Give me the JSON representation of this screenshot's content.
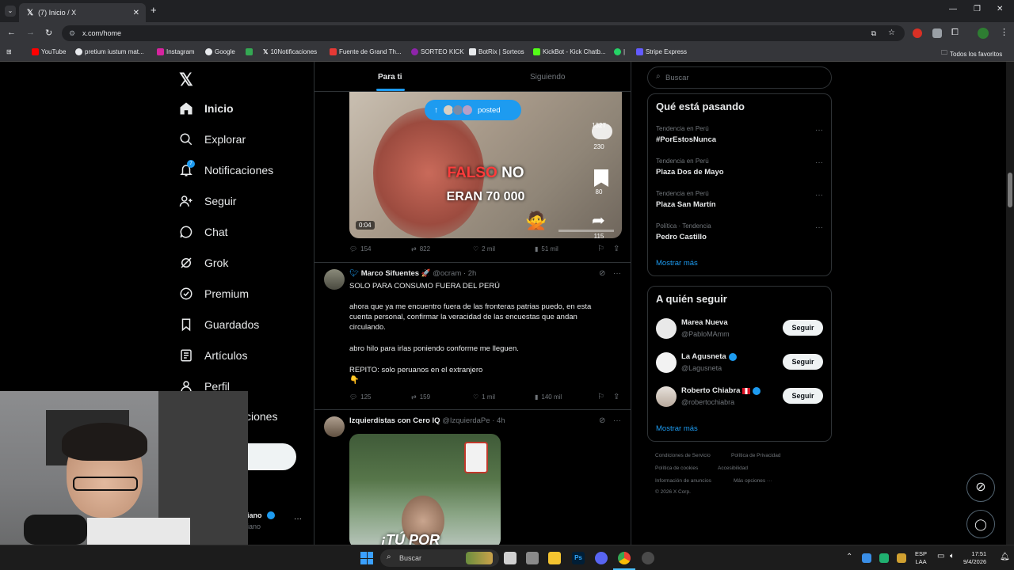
{
  "browser": {
    "tab_title": "(7) Inicio / X",
    "url": "x.com/home",
    "bookmarks": [
      "YouTube",
      "pretium iustum mat...",
      "Instagram",
      "Google",
      "10Notificaciones",
      "Fuente de Grand Th...",
      "SORTEO KICK",
      "BotRix | Sorteos",
      "KickBot - Kick Chatb...",
      "|",
      "Stripe Express"
    ],
    "all_favorites": "Todos los favoritos"
  },
  "nav": {
    "items": [
      "Inicio",
      "Explorar",
      "Notificaciones",
      "Seguir",
      "Chat",
      "Grok",
      "Premium",
      "Guardados",
      "Artículos",
      "Perfil",
      "ciones"
    ],
    "notif_badge": "7",
    "account_name_fragment": "iano",
    "account_handle_fragment": "iano",
    "more": "···"
  },
  "feed": {
    "tabs": [
      "Para ti",
      "Siguiendo"
    ],
    "posted_pill": "posted",
    "video": {
      "caption_red": "FALSO",
      "caption_white": "NO",
      "caption_line2": "ERAN 70 000",
      "duration": "0:04",
      "side_counts": [
        "1327",
        "230",
        "80",
        "115"
      ]
    },
    "tweets": [
      {
        "actions": [
          "154",
          "822",
          "2 mil",
          "51 mil"
        ]
      },
      {
        "name": "Marco Sifuentes",
        "handle": "@ocram",
        "time": "· 2h",
        "lines": [
          "SOLO PARA CONSUMO FUERA DEL PERÚ",
          "ahora que ya me encuentro fuera de las fronteras patrias puedo, en esta",
          "cuenta personal, confirmar la veracidad de las encuestas que andan",
          "circulando.",
          "abro hilo para irlas poniendo conforme me lleguen.",
          "REPITO: solo peruanos en el extranjero"
        ],
        "actions": [
          "125",
          "159",
          "1 mil",
          "140 mil"
        ]
      },
      {
        "name": "Izquierdistas con Cero IQ",
        "handle": "@IzquierdaPe",
        "time": "· 4h",
        "video_text": "¡TÚ POR"
      }
    ]
  },
  "search": {
    "placeholder": "Buscar"
  },
  "trends": {
    "title": "Qué está pasando",
    "items": [
      {
        "context": "Tendencia en Perú",
        "name": "#PorEstosNunca"
      },
      {
        "context": "Tendencia en Perú",
        "name": "Plaza Dos de Mayo"
      },
      {
        "context": "Tendencia en Perú",
        "name": "Plaza San Martín"
      },
      {
        "context": "Política · Tendencia",
        "name": "Pedro Castillo"
      }
    ],
    "show_more": "Mostrar más"
  },
  "who_to_follow": {
    "title": "A quién seguir",
    "users": [
      {
        "name": "Marea Nueva",
        "handle": "@PabloMAmm",
        "button": "Seguir"
      },
      {
        "name": "La Agusneta",
        "handle": "@Lagusneta",
        "button": "Seguir"
      },
      {
        "name": "Roberto Chiabra",
        "handle": "@robertochiabra",
        "button": "Seguir"
      }
    ],
    "show_more": "Mostrar más"
  },
  "footer": {
    "links": [
      "Condiciones de Servicio",
      "Política de Privacidad",
      "Política de cookies",
      "Accesibilidad",
      "Información de anuncios",
      "Más opciones ···"
    ],
    "copyright": "© 2026 X Corp."
  },
  "taskbar": {
    "search": "Buscar",
    "lang": "ESP",
    "lang2": "LAA",
    "time": "17:51",
    "date": "9/4/2026"
  },
  "colors": {
    "accent": "#1d9bf0",
    "background": "#000000",
    "border": "#2f3336",
    "muted": "#71767b"
  }
}
